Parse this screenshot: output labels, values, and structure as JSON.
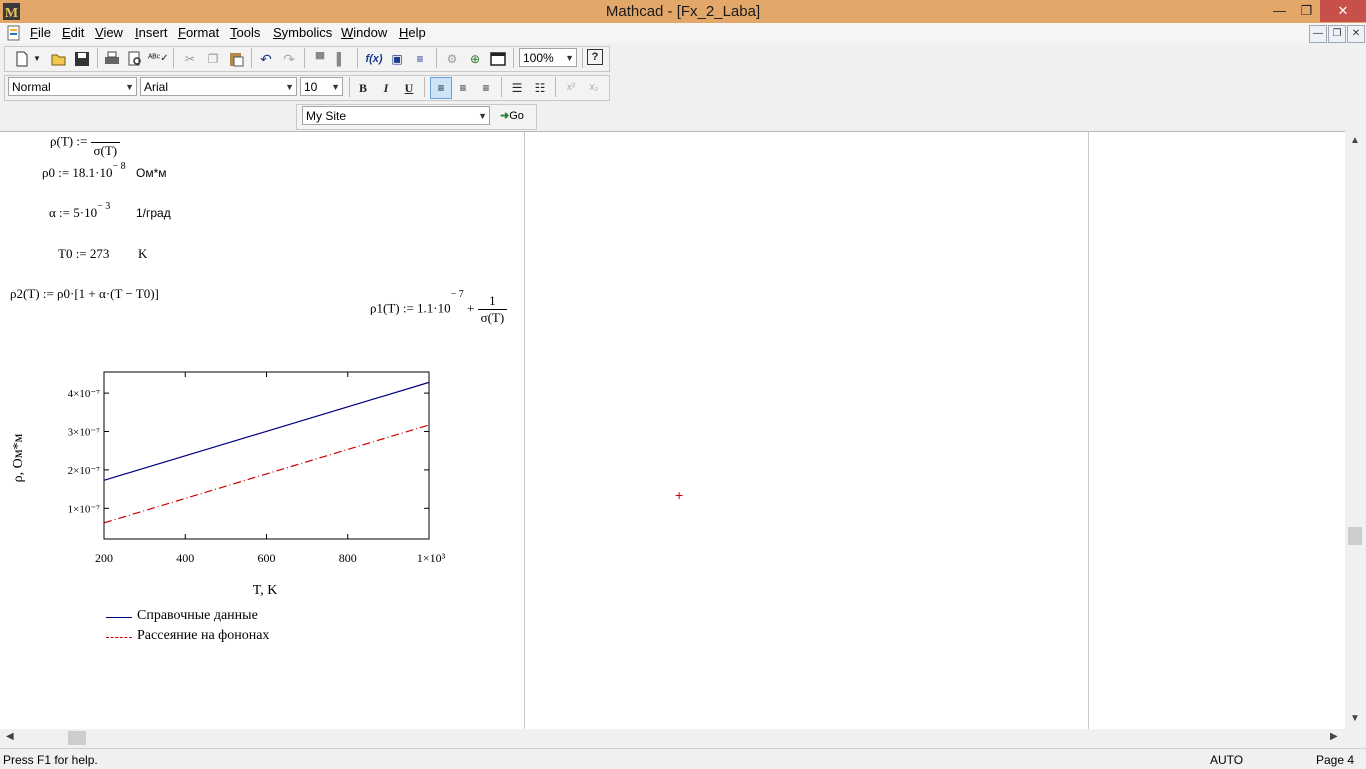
{
  "window": {
    "app_logo": "M",
    "title": "Mathcad - [Fx_2_Laba]",
    "buttons": {
      "minimize": "—",
      "restore": "❐",
      "close": "✕"
    }
  },
  "menu": {
    "items": [
      {
        "key": "F",
        "rest": "ile"
      },
      {
        "key": "E",
        "rest": "dit"
      },
      {
        "key": "V",
        "rest": "iew"
      },
      {
        "key": "I",
        "rest": "nsert"
      },
      {
        "key": "F",
        "rest": "ormat"
      },
      {
        "key": "T",
        "rest": "ools"
      },
      {
        "key": "S",
        "rest": "ymbolics"
      },
      {
        "key": "W",
        "rest": "indow"
      },
      {
        "key": "H",
        "rest": "elp"
      }
    ],
    "mdi_buttons": {
      "minimize": "—",
      "restore": "❐",
      "close": "✕"
    }
  },
  "toolbar": {
    "zoom": "100%",
    "style": "Normal",
    "font": "Arial",
    "size": "10",
    "bold": "B",
    "italic": "I",
    "underline": "U",
    "resources": "My Site",
    "go": "Go",
    "superscript": "x²",
    "subscript": "x₂"
  },
  "worksheet": {
    "partial_def": {
      "lhs": "ρ(T) :=",
      "den": "σ(T)"
    },
    "rho0": {
      "expr": "ρ0 := 18.1·10",
      "exp": "− 8",
      "unit": "Ом*м"
    },
    "alpha": {
      "expr": "α := 5·10",
      "exp": "− 3",
      "unit": "1/град"
    },
    "t0": {
      "expr": "T0 := 273",
      "unit": "K"
    },
    "rho2": "ρ2(T) := ρ0·[1 + α·(T − T0)]",
    "rho1": {
      "lhs": "ρ1(T) := 1.1·10",
      "exp": "− 7",
      "plus": "+",
      "num": "1",
      "den": "σ(T)"
    },
    "cursor": "+"
  },
  "chart_data": {
    "type": "line",
    "xlabel": "T, K",
    "ylabel": "ρ, Ом*м",
    "xlim": [
      200,
      1000
    ],
    "ylim": [
      2e-08,
      4.55e-07
    ],
    "x_ticks": [
      "200",
      "400",
      "600",
      "800",
      "1×10³"
    ],
    "y_ticks": [
      "1×10⁻⁷",
      "2×10⁻⁷",
      "3×10⁻⁷",
      "4×10⁻⁷"
    ],
    "series": [
      {
        "name": "Справочные данные",
        "color": "#000080",
        "style": "solid",
        "x": [
          200,
          1000
        ],
        "y": [
          1.73e-07,
          4.28e-07
        ]
      },
      {
        "name": "Рассеяние на фононах",
        "color": "#cc0000",
        "style": "dashdot",
        "x": [
          200,
          1000
        ],
        "y": [
          6.2e-08,
          3.17e-07
        ]
      }
    ],
    "legend_position": "bottom-left"
  },
  "statusbar": {
    "help": "Press F1 for help.",
    "mode": "AUTO",
    "page": "Page 4"
  }
}
